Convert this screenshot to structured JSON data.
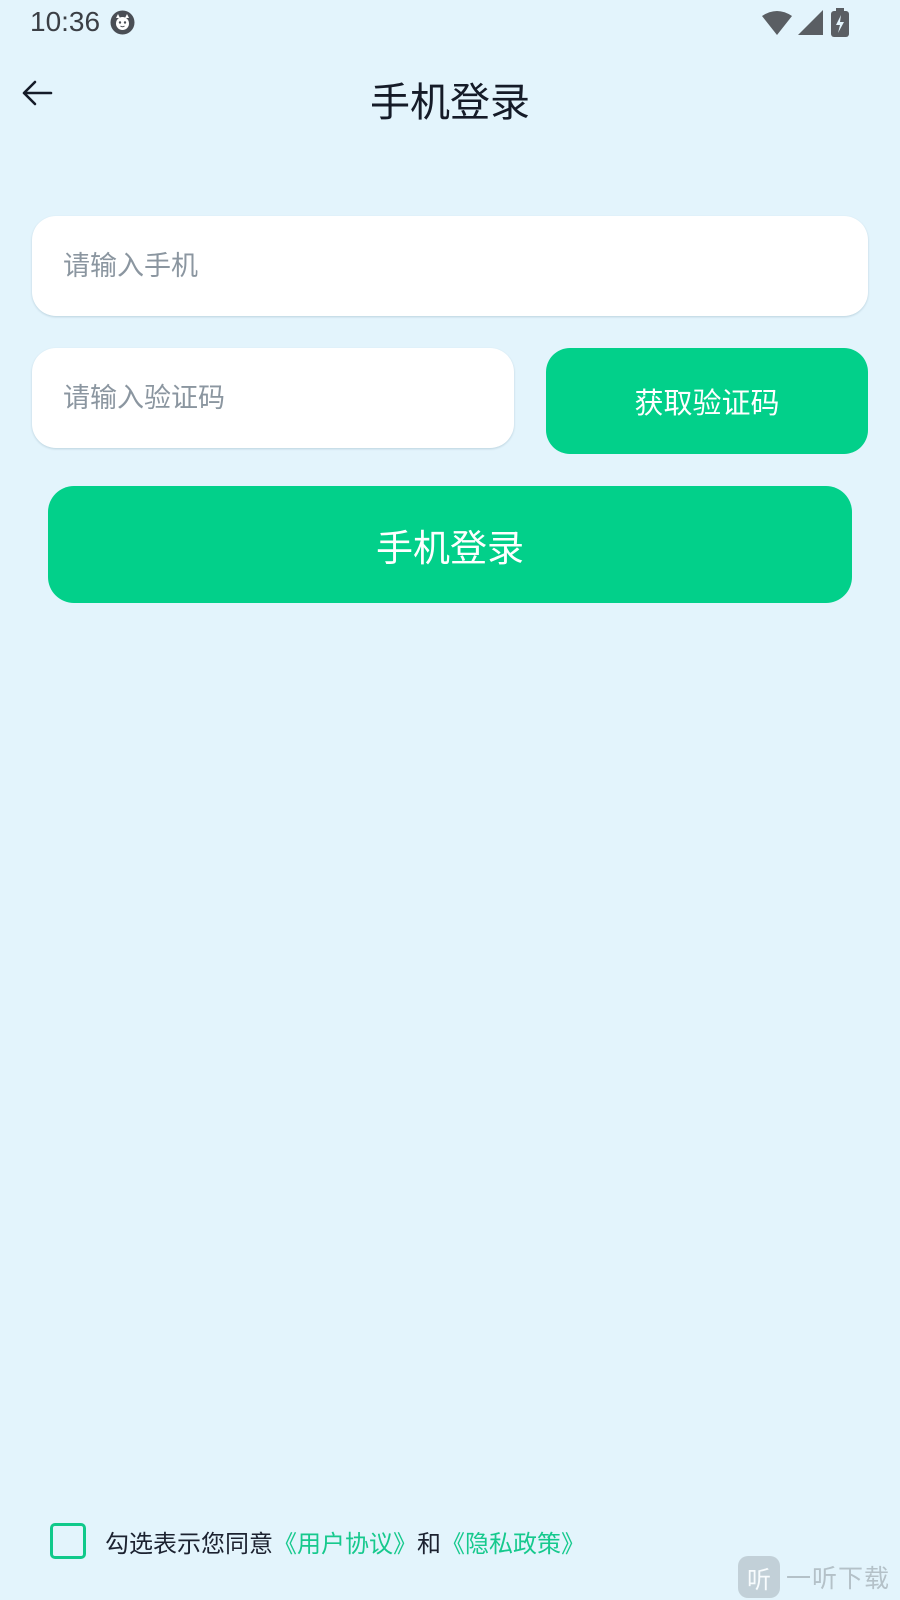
{
  "status_bar": {
    "time": "10:36",
    "icons": [
      "cat-face-icon",
      "wifi-icon",
      "signal-icon",
      "battery-charging-icon"
    ]
  },
  "header": {
    "back_icon": "arrow-left-icon",
    "title": "手机登录"
  },
  "form": {
    "phone_placeholder": "请输入手机",
    "phone_value": "",
    "code_placeholder": "请输入验证码",
    "code_value": "",
    "get_code_label": "获取验证码",
    "login_label": "手机登录"
  },
  "agreement": {
    "checked": false,
    "prefix": "勾选表示您同意",
    "user_agreement": "《用户协议》",
    "conjunction": "和",
    "privacy_policy": "《隐私政策》"
  },
  "watermark": {
    "logo_char": "听",
    "text": "一听下载"
  },
  "colors": {
    "background": "#e3f4fc",
    "accent": "#02d08a",
    "link": "#16c98d",
    "input_background": "#ffffff"
  }
}
